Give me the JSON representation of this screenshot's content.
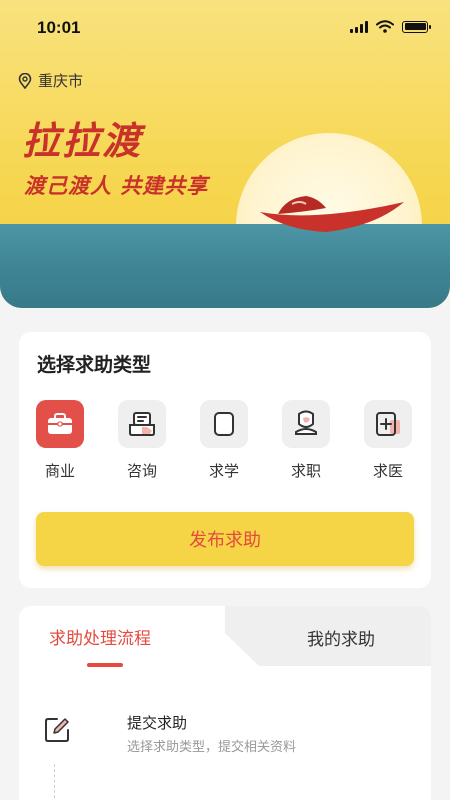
{
  "status_bar": {
    "time": "10:01"
  },
  "location": {
    "city": "重庆市",
    "icon": "location-pin-icon"
  },
  "hero": {
    "title": "拉拉渡",
    "slogan": "渡己渡人 共建共享"
  },
  "help_types": {
    "title": "选择求助类型",
    "items": [
      {
        "label": "商业",
        "icon": "briefcase-icon",
        "active": true
      },
      {
        "label": "咨询",
        "icon": "consult-icon",
        "active": false
      },
      {
        "label": "求学",
        "icon": "study-icon",
        "active": false
      },
      {
        "label": "求职",
        "icon": "job-icon",
        "active": false
      },
      {
        "label": "求医",
        "icon": "medical-icon",
        "active": false
      }
    ],
    "publish_button": "发布求助"
  },
  "process": {
    "tabs": [
      {
        "label": "求助处理流程",
        "active": true
      },
      {
        "label": "我的求助",
        "active": false
      }
    ],
    "steps": [
      {
        "title": "提交求助",
        "desc": "选择求助类型，提交相关资料",
        "icon": "edit-icon"
      }
    ]
  },
  "colors": {
    "brand_red": "#e44a3f",
    "brand_yellow": "#f5d445",
    "sea": "#3f8596"
  }
}
